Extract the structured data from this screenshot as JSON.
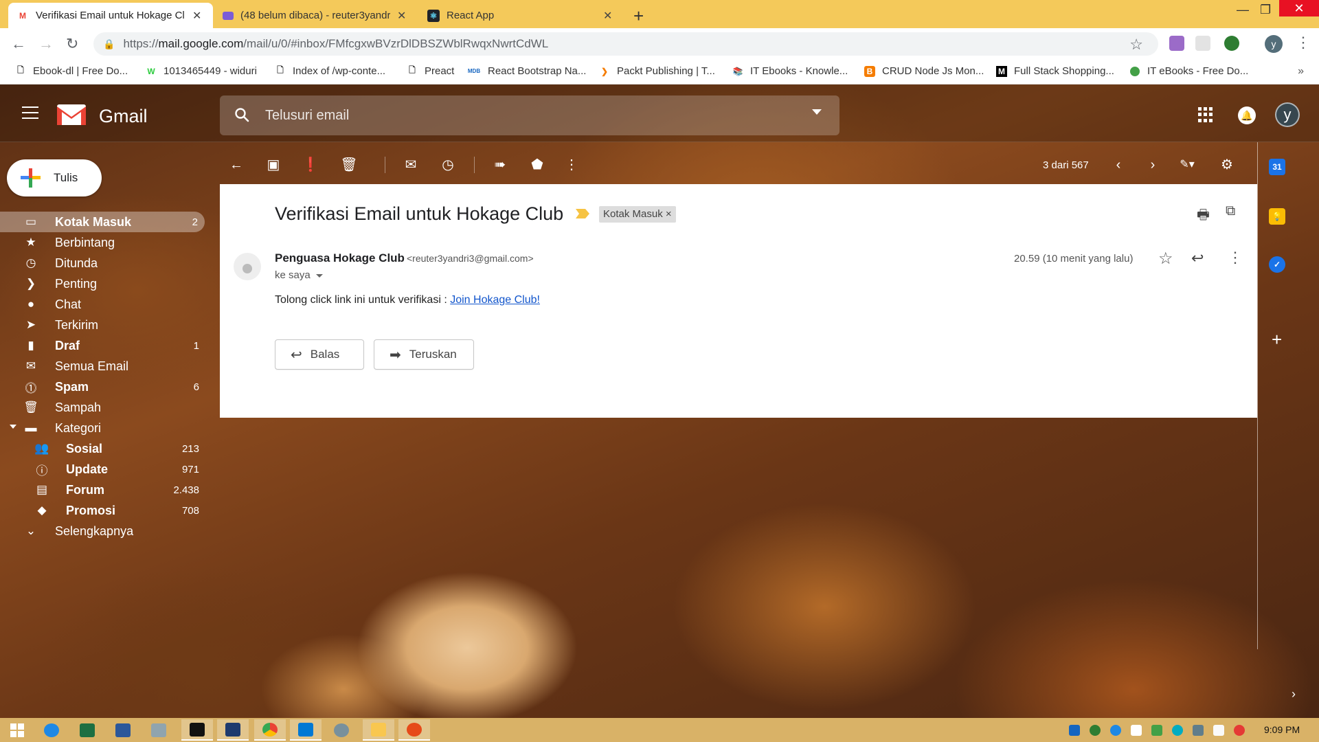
{
  "browser": {
    "tabs": [
      {
        "title": "Verifikasi Email untuk Hokage Cl",
        "favicon": "gmail-icon",
        "active": true
      },
      {
        "title": "(48 belum dibaca) - reuter3yandr",
        "favicon": "yahoo-mail-icon",
        "active": false
      },
      {
        "title": "React App",
        "favicon": "react-icon",
        "active": false
      }
    ],
    "new_tab": "+",
    "address": {
      "scheme": "https://",
      "host": "mail.google.com",
      "path": "/mail/u/0/#inbox/FMfcgxwBVzrDlDBSZWblRwqxNwrtCdWL"
    },
    "profile_initial": "y",
    "bookmarks": [
      {
        "label": "Ebook-dl | Free Do...",
        "icon": "page-icon"
      },
      {
        "label": "1013465449 - widuri",
        "icon": "widuri-icon"
      },
      {
        "label": "Index of /wp-conte...",
        "icon": "page-icon"
      },
      {
        "label": "Preact",
        "icon": "page-icon"
      },
      {
        "label": "React Bootstrap Na...",
        "icon": "mdb-icon"
      },
      {
        "label": "Packt Publishing | T...",
        "icon": "packt-icon"
      },
      {
        "label": "IT Ebooks - Knowle...",
        "icon": "books-icon"
      },
      {
        "label": "CRUD Node Js Mon...",
        "icon": "blogger-icon"
      },
      {
        "label": "Full Stack Shopping...",
        "icon": "medium-icon"
      },
      {
        "label": "IT eBooks - Free Do...",
        "icon": "green-dot-icon"
      }
    ],
    "bookmarks_more": "»"
  },
  "gmail": {
    "brand": "Gmail",
    "search_placeholder": "Telusuri email",
    "avatar_initial": "y",
    "compose_label": "Tulis",
    "nav": [
      {
        "label": "Kotak Masuk",
        "count": "2",
        "icon": "inbox-icon",
        "active": true,
        "bold": true
      },
      {
        "label": "Berbintang",
        "count": "",
        "icon": "star-icon"
      },
      {
        "label": "Ditunda",
        "count": "",
        "icon": "clock-icon"
      },
      {
        "label": "Penting",
        "count": "",
        "icon": "important-icon"
      },
      {
        "label": "Chat",
        "count": "",
        "icon": "chat-icon"
      },
      {
        "label": "Terkirim",
        "count": "",
        "icon": "send-icon"
      },
      {
        "label": "Draf",
        "count": "1",
        "icon": "draft-icon",
        "bold": true
      },
      {
        "label": "Semua Email",
        "count": "",
        "icon": "all-mail-icon"
      },
      {
        "label": "Spam",
        "count": "6",
        "icon": "spam-icon",
        "bold": true
      },
      {
        "label": "Sampah",
        "count": "",
        "icon": "trash-icon"
      },
      {
        "label": "Kategori",
        "count": "",
        "icon": "label-icon"
      },
      {
        "label": "Sosial",
        "count": "213",
        "icon": "people-icon",
        "sub": true
      },
      {
        "label": "Update",
        "count": "971",
        "icon": "info-icon",
        "sub": true
      },
      {
        "label": "Forum",
        "count": "2.438",
        "icon": "forum-icon",
        "sub": true
      },
      {
        "label": "Promosi",
        "count": "708",
        "icon": "tag-icon",
        "sub": true
      },
      {
        "label": "Selengkapnya",
        "count": "",
        "icon": "chevron-down-icon"
      }
    ],
    "pager_text": "3 dari 567",
    "message": {
      "subject": "Verifikasi Email untuk Hokage Club",
      "label_chip": "Kotak Masuk",
      "label_chip_close": "×",
      "sender_name": "Penguasa Hokage Club",
      "sender_email": "<reuter3yandri3@gmail.com>",
      "recipient": "ke saya",
      "time": "20.59 (10 menit yang lalu)",
      "body_prefix": "Tolong click link ini untuk verifikasi : ",
      "body_link": "Join Hokage Club!",
      "reply_label": "Balas",
      "forward_label": "Teruskan"
    }
  },
  "taskbar": {
    "clock": "9:09 PM"
  },
  "colors": {
    "tab_strip": "#f4c95a",
    "taskbar": "#d9b267",
    "link": "#1155cc",
    "gmail_red": "#ea4335"
  }
}
